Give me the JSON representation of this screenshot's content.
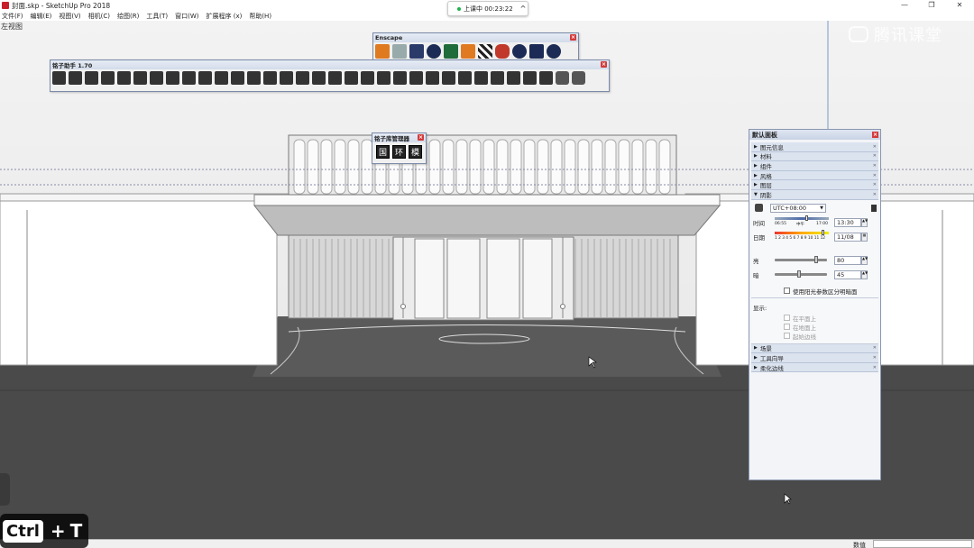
{
  "window": {
    "title": "封面.skp - SketchUp Pro 2018",
    "controls": [
      "—",
      "❐",
      "✕"
    ]
  },
  "menu": [
    "文件(F)",
    "编辑(E)",
    "视图(V)",
    "相机(C)",
    "绘图(R)",
    "工具(T)",
    "窗口(W)",
    "扩展程序 (x)",
    "帮助(H)"
  ],
  "status_pill": {
    "label": "上课中 00:23:22",
    "chevron": "^"
  },
  "viewport": {
    "scene_label": "左视图"
  },
  "watermark": {
    "text": "腾讯课堂"
  },
  "enscape": {
    "title": "Enscape",
    "icons": [
      "enscape-start-icon",
      "refresh-icon",
      "layers-icon",
      "plus-icon",
      "tree-icon",
      "chart-icon",
      "checker-icon",
      "cloud-icon",
      "gear-icon",
      "mail-icon",
      "info-icon"
    ]
  },
  "zhizi": {
    "title": "铭子助手 1.70",
    "icon_count": 33
  },
  "library": {
    "title": "铭子库管理器",
    "buttons": [
      "国",
      "环",
      "模"
    ]
  },
  "tray": {
    "title": "默认面板",
    "sections_top": [
      {
        "label": "图元信息",
        "arrow": "▶"
      },
      {
        "label": "材料",
        "arrow": "▶"
      },
      {
        "label": "组件",
        "arrow": "▶"
      },
      {
        "label": "风格",
        "arrow": "▶"
      },
      {
        "label": "图层",
        "arrow": "▶"
      },
      {
        "label": "阴影",
        "arrow": "▼"
      }
    ],
    "shadows": {
      "timezone": "UTC+08:00",
      "time_label": "时间",
      "time_start": "06:55",
      "time_noon": "中午",
      "time_end": "17:00",
      "time_value": "13:30",
      "date_label": "日期",
      "date_months": "1 2 3 4 5 6 7 8 9 10 11 12",
      "date_value": "11/08",
      "light_label": "亮",
      "light_value": "80",
      "dark_label": "暗",
      "dark_value": "45",
      "sun_checkbox": "使用阳光参数区分明暗面",
      "display_label": "显示:",
      "display_opts": [
        "在平面上",
        "在地面上",
        "起始边线"
      ]
    },
    "sections_bottom": [
      {
        "label": "场景",
        "arrow": "▶"
      },
      {
        "label": "工具向导",
        "arrow": "▶"
      },
      {
        "label": "柔化边线",
        "arrow": "▶"
      }
    ]
  },
  "statusbar": {
    "value_label": "数值"
  },
  "keystroke": {
    "key1": "Ctrl",
    "plus": "+",
    "key2": "T"
  },
  "colors": {
    "ground": "#4a4a4a",
    "sky": "#f0f0f0",
    "toolbar_border": "#7a8aa8",
    "close_red": "#d23a3a"
  }
}
